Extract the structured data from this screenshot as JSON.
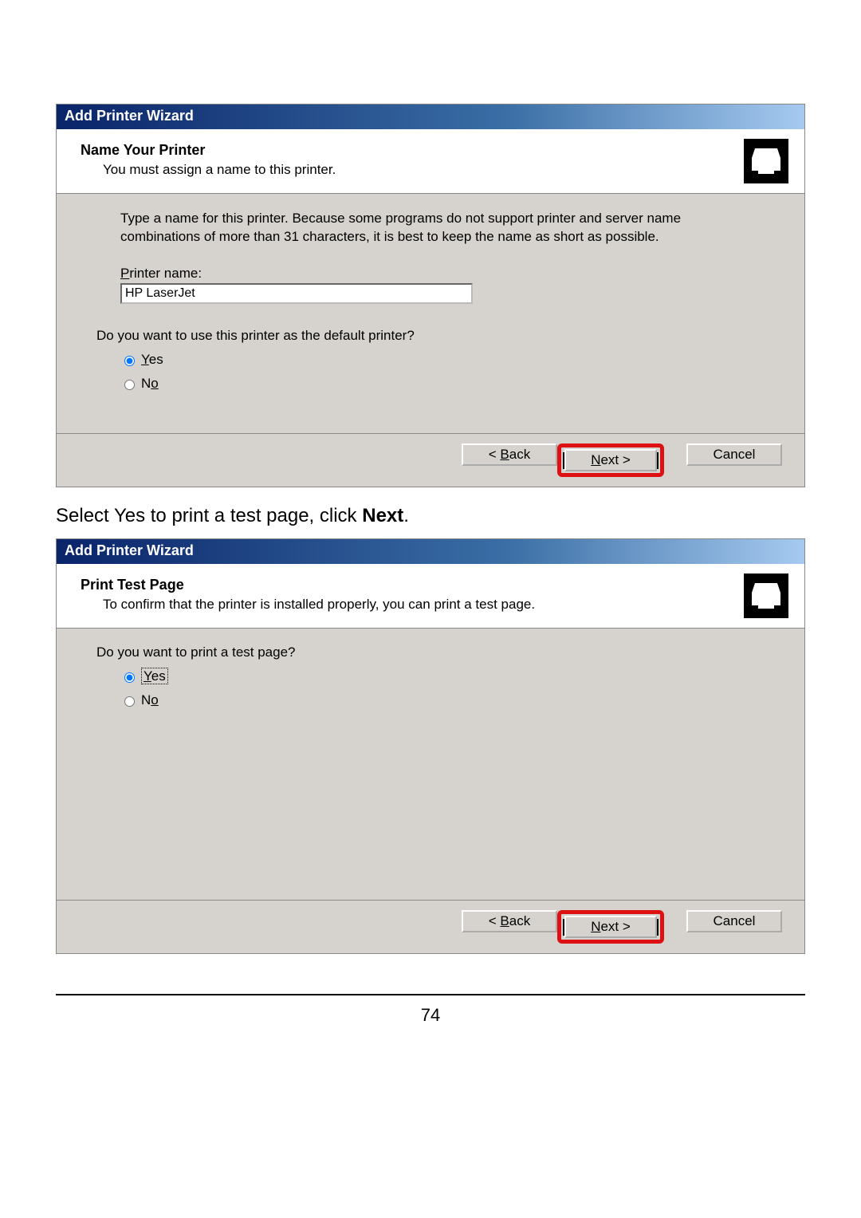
{
  "wizard1": {
    "title": "Add Printer Wizard",
    "header_title": "Name Your Printer",
    "header_subtitle": "You must assign a name to this printer.",
    "instruction": "Type a name for this printer. Because some programs do not support printer and server name combinations of more than 31 characters, it is best to keep the name as short as possible.",
    "field_label_pre": "P",
    "field_label_post": "rinter name:",
    "printer_name_value": "HP LaserJet",
    "default_question": "Do you want to use this printer as the default printer?",
    "radio_yes_u": "Y",
    "radio_yes_rest": "es",
    "radio_no_pre": "N",
    "radio_no_u": "o",
    "back_lt": "< ",
    "back_u": "B",
    "back_rest": "ack",
    "next_u": "N",
    "next_rest": "ext >",
    "cancel": "Cancel"
  },
  "caption": {
    "pre": "Select Yes to print a test page, click ",
    "bold": "Next",
    "post": "."
  },
  "wizard2": {
    "title": "Add Printer Wizard",
    "header_title": "Print Test Page",
    "header_subtitle": "To confirm that the printer is installed properly, you can print a test page.",
    "question": "Do you want to print a test page?",
    "radio_yes_u": "Y",
    "radio_yes_rest": "es",
    "radio_no_pre": "N",
    "radio_no_u": "o",
    "back_lt": "< ",
    "back_u": "B",
    "back_rest": "ack",
    "next_u": "N",
    "next_rest": "ext >",
    "cancel": "Cancel"
  },
  "page_number": "74"
}
